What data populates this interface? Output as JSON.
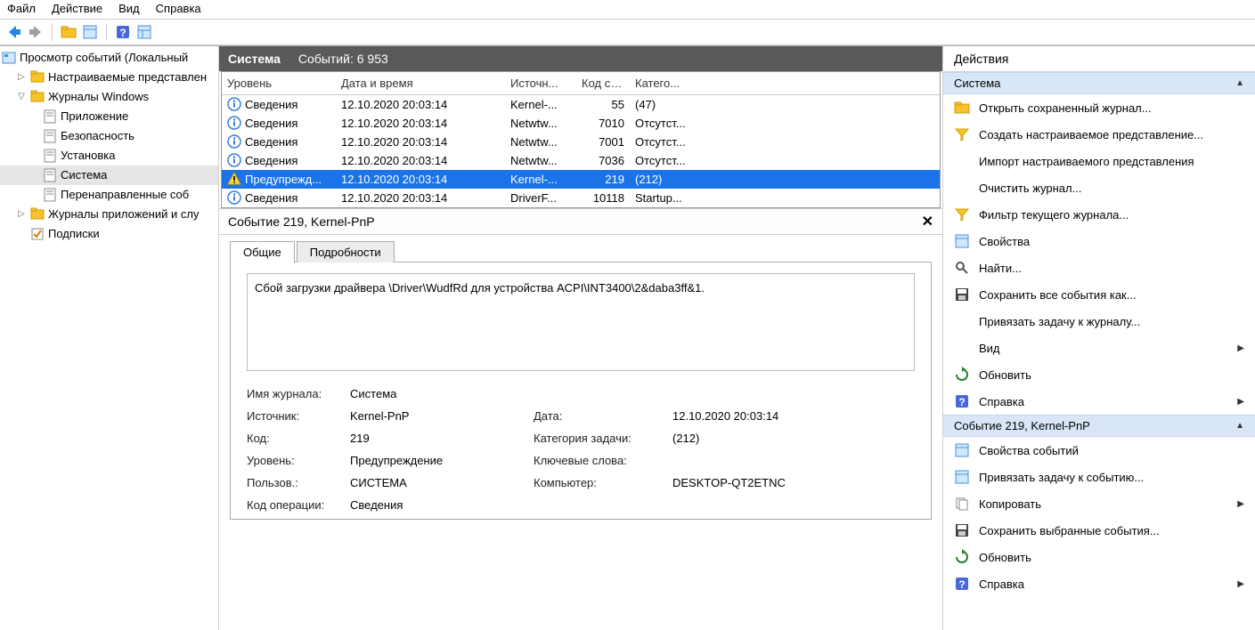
{
  "menu": {
    "file": "Файл",
    "action": "Действие",
    "view": "Вид",
    "help": "Справка"
  },
  "tree": {
    "root": "Просмотр событий (Локальный",
    "custom_views": "Настраиваемые представлен",
    "win_logs": "Журналы Windows",
    "application": "Приложение",
    "security": "Безопасность",
    "setup": "Установка",
    "system": "Система",
    "forwarded": "Перенаправленные соб",
    "app_services": "Журналы приложений и слу",
    "subscriptions": "Подписки"
  },
  "center": {
    "title": "Система",
    "count_label": "Событий: 6 953",
    "columns": {
      "level": "Уровень",
      "date": "Дата и время",
      "source": "Источн...",
      "id": "Код со...",
      "category": "Катего..."
    },
    "rows": [
      {
        "level": "Сведения",
        "icon": "info",
        "date": "12.10.2020 20:03:14",
        "source": "Kernel-...",
        "id": "55",
        "category": "(47)"
      },
      {
        "level": "Сведения",
        "icon": "info",
        "date": "12.10.2020 20:03:14",
        "source": "Netwtw...",
        "id": "7010",
        "category": "Отсутст..."
      },
      {
        "level": "Сведения",
        "icon": "info",
        "date": "12.10.2020 20:03:14",
        "source": "Netwtw...",
        "id": "7001",
        "category": "Отсутст..."
      },
      {
        "level": "Сведения",
        "icon": "info",
        "date": "12.10.2020 20:03:14",
        "source": "Netwtw...",
        "id": "7036",
        "category": "Отсутст..."
      },
      {
        "level": "Предупрежд...",
        "icon": "warn",
        "date": "12.10.2020 20:03:14",
        "source": "Kernel-...",
        "id": "219",
        "category": "(212)"
      },
      {
        "level": "Сведения",
        "icon": "info",
        "date": "12.10.2020 20:03:14",
        "source": "DriverF...",
        "id": "10118",
        "category": "Startup..."
      }
    ]
  },
  "detail": {
    "header": "Событие 219, Kernel-PnP",
    "tab_general": "Общие",
    "tab_details": "Подробности",
    "message": "Сбой загрузки драйвера \\Driver\\WudfRd для устройства ACPI\\INT3400\\2&daba3ff&1.",
    "labels": {
      "log_name": "Имя журнала:",
      "source": "Источник:",
      "id": "Код:",
      "level": "Уровень:",
      "user": "Пользов.:",
      "opcode": "Код операции:",
      "date": "Дата:",
      "task_cat": "Категория задачи:",
      "keywords": "Ключевые слова:",
      "computer": "Компьютер:"
    },
    "values": {
      "log_name": "Система",
      "source": "Kernel-PnP",
      "id": "219",
      "level": "Предупреждение",
      "user": "СИСТЕМА",
      "opcode": "Сведения",
      "date": "12.10.2020 20:03:14",
      "task_cat": "(212)",
      "keywords": "",
      "computer": "DESKTOP-QT2ETNC"
    }
  },
  "actions": {
    "title": "Действия",
    "group1": "Система",
    "items1": [
      {
        "label": "Открыть сохраненный журнал...",
        "icon": "folder"
      },
      {
        "label": "Создать настраиваемое представление...",
        "icon": "funnel"
      },
      {
        "label": "Импорт настраиваемого представления",
        "icon": "none"
      },
      {
        "label": "Очистить журнал...",
        "icon": "none"
      },
      {
        "label": "Фильтр текущего журнала...",
        "icon": "funnel"
      },
      {
        "label": "Свойства",
        "icon": "props"
      },
      {
        "label": "Найти...",
        "icon": "find"
      },
      {
        "label": "Сохранить все события как...",
        "icon": "save"
      },
      {
        "label": "Привязать задачу к журналу...",
        "icon": "none"
      },
      {
        "label": "Вид",
        "icon": "none",
        "arrow": true
      },
      {
        "label": "Обновить",
        "icon": "refresh"
      },
      {
        "label": "Справка",
        "icon": "help",
        "arrow": true
      }
    ],
    "group2": "Событие 219, Kernel-PnP",
    "items2": [
      {
        "label": "Свойства событий",
        "icon": "props"
      },
      {
        "label": "Привязать задачу к событию...",
        "icon": "props"
      },
      {
        "label": "Копировать",
        "icon": "copy",
        "arrow": true
      },
      {
        "label": "Сохранить выбранные события...",
        "icon": "save"
      },
      {
        "label": "Обновить",
        "icon": "refresh"
      },
      {
        "label": "Справка",
        "icon": "help",
        "arrow": true
      }
    ]
  }
}
